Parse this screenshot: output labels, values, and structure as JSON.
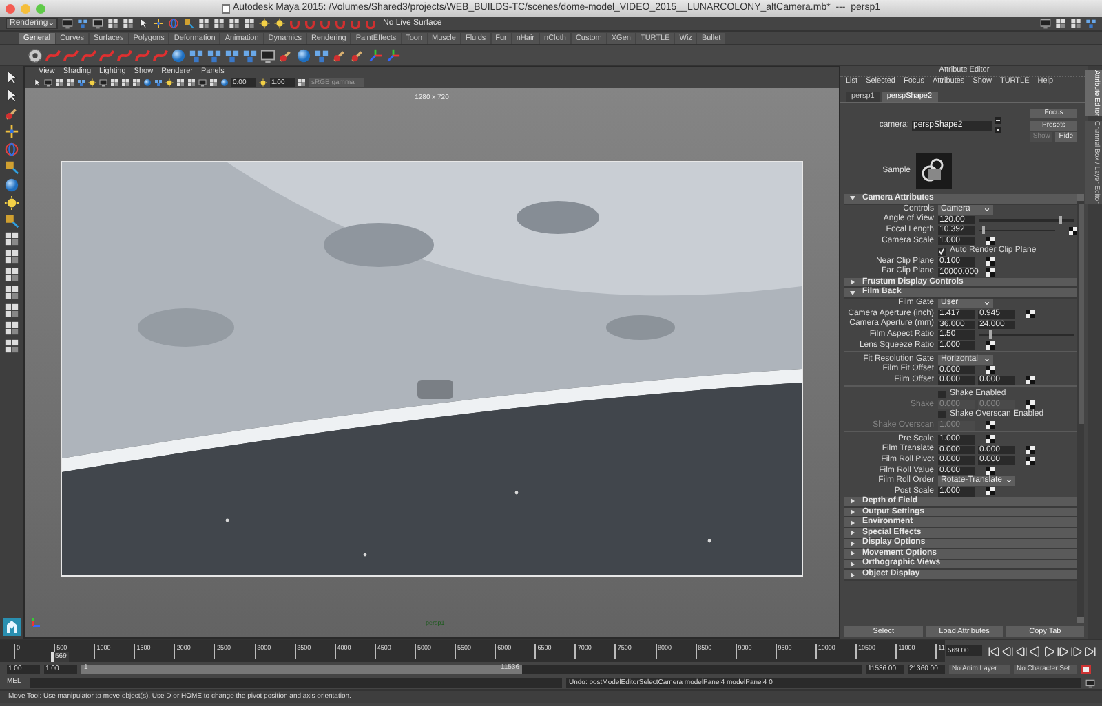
{
  "window": {
    "title": "Autodesk Maya 2015: /Volumes/Shared3/projects/WEB_BUILDS-TC/scenes/dome-model_VIDEO_2015__LUNARCOLONY_altCamera.mb*  ---  persp1"
  },
  "status_line": {
    "menu_set": "Rendering",
    "live_surface": "No Live Surface"
  },
  "shelf": {
    "tabs": [
      {
        "label": "General",
        "selected": true
      },
      {
        "label": "Curves",
        "selected": false
      },
      {
        "label": "Surfaces",
        "selected": false
      },
      {
        "label": "Polygons",
        "selected": false
      },
      {
        "label": "Deformation",
        "selected": false
      },
      {
        "label": "Animation",
        "selected": false
      },
      {
        "label": "Dynamics",
        "selected": false
      },
      {
        "label": "Rendering",
        "selected": false
      },
      {
        "label": "PaintEffects",
        "selected": false
      },
      {
        "label": "Toon",
        "selected": false
      },
      {
        "label": "Muscle",
        "selected": false
      },
      {
        "label": "Fluids",
        "selected": false
      },
      {
        "label": "Fur",
        "selected": false
      },
      {
        "label": "nHair",
        "selected": false
      },
      {
        "label": "nCloth",
        "selected": false
      },
      {
        "label": "Custom",
        "selected": false
      },
      {
        "label": "XGen",
        "selected": false
      },
      {
        "label": "TURTLE",
        "selected": false
      },
      {
        "label": "Wiz",
        "selected": false
      },
      {
        "label": "Bullet",
        "selected": false
      }
    ]
  },
  "viewport": {
    "menu": [
      "View",
      "Shading",
      "Lighting",
      "Show",
      "Renderer",
      "Panels"
    ],
    "exposure": "0.00",
    "gamma": "1.00",
    "color_space": "sRGB gamma",
    "resolution": "1280 x 720",
    "camera": "persp1",
    "image": {
      "kind": "picture"
    }
  },
  "attribute_editor": {
    "title": "Attribute Editor",
    "menu": [
      "List",
      "Selected",
      "Focus",
      "Attributes",
      "Show",
      "TURTLE",
      "Help"
    ],
    "tabs": [
      {
        "label": "persp1",
        "selected": false
      },
      {
        "label": "perspShape2",
        "selected": true
      }
    ],
    "node_label": "camera:",
    "node_value": "perspShape2",
    "buttons": [
      {
        "label": "Focus",
        "disabled": false
      },
      {
        "label": "Presets",
        "disabled": false
      },
      {
        "label": "Show",
        "disabled": true
      },
      {
        "label": "Hide",
        "disabled": false
      }
    ],
    "sample_label": "Sample",
    "sections": [
      {
        "title": "Camera Attributes",
        "expanded": true,
        "groups": [
          {
            "rows": [
              {
                "kind": "dropdown",
                "label": "Controls",
                "value": "Camera",
                "disabled": false
              },
              {
                "kind": "slider",
                "label": "Angle of View",
                "values": [
                  "120.00"
                ],
                "level": 0.84,
                "map": false,
                "disabled": false
              },
              {
                "kind": "slider",
                "label": "Focal Length",
                "values": [
                  "10.392"
                ],
                "level": 0.03,
                "map": true,
                "disabled": false
              },
              {
                "kind": "fields",
                "label": "Camera Scale",
                "values": [
                  "1.000"
                ],
                "map": true,
                "disabled": false
              },
              {
                "kind": "checkbox",
                "label": "Auto Render Clip Plane",
                "checked": true,
                "disabled": false
              },
              {
                "kind": "fields",
                "label": "Near Clip Plane",
                "values": [
                  "0.100"
                ],
                "map": true,
                "disabled": false
              },
              {
                "kind": "fields",
                "label": "Far Clip Plane",
                "values": [
                  "10000.000"
                ],
                "map": true,
                "disabled": false
              }
            ]
          }
        ]
      },
      {
        "title": "Frustum Display Controls",
        "expanded": false
      },
      {
        "title": "Film Back",
        "expanded": true,
        "groups": [
          {
            "rows": [
              {
                "kind": "dropdown",
                "label": "Film Gate",
                "value": "User",
                "disabled": false
              },
              {
                "kind": "fields",
                "label": "Camera Aperture (inch)",
                "values": [
                  "1.417",
                  "0.945"
                ],
                "map": true,
                "disabled": false
              },
              {
                "kind": "fields",
                "label": "Camera Aperture (mm)",
                "values": [
                  "36.000",
                  "24.000"
                ],
                "map": false,
                "disabled": false
              },
              {
                "kind": "slider",
                "label": "Film Aspect Ratio",
                "values": [
                  "1.50"
                ],
                "level": 0.1,
                "map": false,
                "disabled": false
              },
              {
                "kind": "fields",
                "label": "Lens Squeeze Ratio",
                "values": [
                  "1.000"
                ],
                "map": true,
                "disabled": false
              }
            ]
          },
          {
            "rows": [
              {
                "kind": "dropdown",
                "label": "Fit Resolution Gate",
                "value": "Horizontal",
                "disabled": false
              },
              {
                "kind": "fields",
                "label": "Film Fit Offset",
                "values": [
                  "0.000"
                ],
                "map": true,
                "disabled": false
              },
              {
                "kind": "fields",
                "label": "Film Offset",
                "values": [
                  "0.000",
                  "0.000"
                ],
                "map": true,
                "disabled": false
              }
            ]
          },
          {
            "rows": [
              {
                "kind": "checkbox",
                "label": "Shake Enabled",
                "checked": false,
                "disabled": false
              },
              {
                "kind": "fields",
                "label": "Shake",
                "values": [
                  "0.000",
                  "0.000"
                ],
                "map": true,
                "disabled": true
              },
              {
                "kind": "checkbox",
                "label": "Shake Overscan Enabled",
                "checked": false,
                "disabled": false
              },
              {
                "kind": "fields",
                "label": "Shake Overscan",
                "values": [
                  "1.000"
                ],
                "map": true,
                "disabled": true
              }
            ]
          },
          {
            "rows": [
              {
                "kind": "fields",
                "label": "Pre Scale",
                "values": [
                  "1.000"
                ],
                "map": true,
                "disabled": false
              },
              {
                "kind": "fields",
                "label": "Film Translate",
                "values": [
                  "0.000",
                  "0.000"
                ],
                "map": true,
                "disabled": false
              },
              {
                "kind": "fields",
                "label": "Film Roll Pivot",
                "values": [
                  "0.000",
                  "0.000"
                ],
                "map": true,
                "disabled": false
              },
              {
                "kind": "fields",
                "label": "Film Roll Value",
                "values": [
                  "0.000"
                ],
                "map": true,
                "disabled": false
              },
              {
                "kind": "dropdown",
                "label": "Film Roll Order",
                "value": "Rotate-Translate",
                "disabled": false
              },
              {
                "kind": "fields",
                "label": "Post Scale",
                "values": [
                  "1.000"
                ],
                "map": true,
                "disabled": false
              }
            ]
          }
        ]
      },
      {
        "title": "Depth of Field",
        "expanded": false
      },
      {
        "title": "Output Settings",
        "expanded": false
      },
      {
        "title": "Environment",
        "expanded": false
      },
      {
        "title": "Special Effects",
        "expanded": false
      },
      {
        "title": "Display Options",
        "expanded": false
      },
      {
        "title": "Movement Options",
        "expanded": false
      },
      {
        "title": "Orthographic Views",
        "expanded": false
      },
      {
        "title": "Object Display",
        "expanded": false
      }
    ],
    "bottom_buttons": [
      "Select",
      "Load Attributes",
      "Copy Tab"
    ]
  },
  "side_tabs": [
    {
      "label": "Attribute Editor",
      "selected": true
    },
    {
      "label": "Channel Box / Layer Editor",
      "selected": false
    }
  ],
  "time_slider": {
    "ticks": [
      "0",
      "500",
      "1000",
      "1500",
      "2000",
      "2500",
      "3000",
      "3500",
      "4000",
      "4500",
      "5000",
      "5500",
      "6000",
      "6500",
      "7000",
      "7500",
      "8000",
      "8500",
      "9000",
      "9500",
      "10000",
      "10500",
      "11000",
      "11"
    ],
    "current_frame": "569",
    "level": 0.054,
    "current_time": "569.00"
  },
  "range_slider": {
    "start": "1.00",
    "playback_start": "1.00",
    "handle_start": "1",
    "handle_end": "11536",
    "playback_end": "11536.00",
    "end": "21360.00",
    "anim_layer": "No Anim Layer",
    "character_set": "No Character Set"
  },
  "command_line": {
    "language": "MEL",
    "result": "Undo: postModelEditorSelectCamera modelPanel4 modelPanel4 0"
  },
  "help_line": "Move Tool: Use manipulator to move object(s). Use D or HOME to change the pivot position and axis orientation."
}
